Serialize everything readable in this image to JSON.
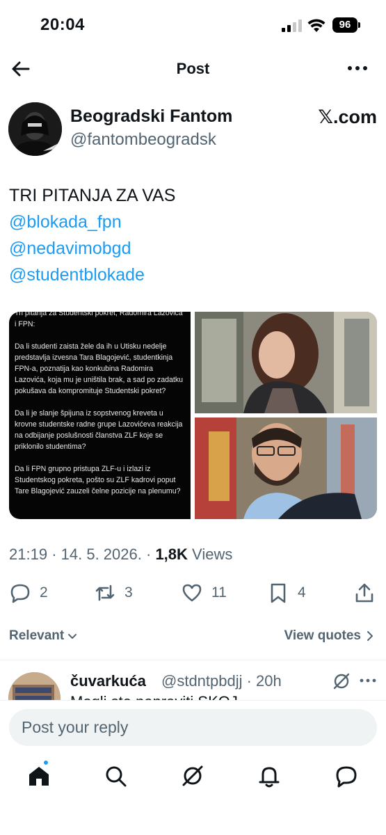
{
  "status_bar": {
    "time": "20:04",
    "battery": "96"
  },
  "nav": {
    "title": "Post"
  },
  "author": {
    "name": "Beogradski Fantom",
    "handle": "@fantombeogradsk",
    "source": "𝕏.com"
  },
  "post": {
    "text_lines": [
      "TRI PITANJA ZA VAS"
    ],
    "mentions": [
      "@blokada_fpn",
      "@nedavimobgd",
      "@studentblokade"
    ],
    "media_text": [
      "Tri pitanja za Studentski pokret, Radomira Lazovića i FPN:",
      "Da li studenti zaista žele da ih u Utisku nedelje predstavlja izvesna Tara Blagojević, studentkinja FPN-a, poznatija kao konkubina Radomira Lazovića, koja mu je uništila brak, a sad po zadatku pokušava da kompromituje Studentski pokret?",
      "Da li je slanje špijuna iz sopstvenog kreveta u krovne studentske radne grupe Lazovićeva reakcija na odbijanje poslušnosti članstva ZLF koje se priklonilo studentima?",
      "Da li FPN grupno pristupa ZLF-u i izlazi iz Studentskog pokreta, pošto su ZLF kadrovi poput Tare Blagojević zauzeli čelne pozicije na plenumu?"
    ]
  },
  "meta": {
    "time": "21:19",
    "date": "14. 5. 2026.",
    "views_count": "1,8K",
    "views_label": "Views"
  },
  "actions": {
    "replies": "2",
    "reposts": "3",
    "likes": "11",
    "bookmarks": "4"
  },
  "filters": {
    "sort_label": "Relevant",
    "quotes_label": "View quotes"
  },
  "reply": {
    "name": "čuvarkuća",
    "handle": "@stdntpbdjj · 20h",
    "text": "Mogli ste napraviti SKOJ..."
  },
  "compose": {
    "placeholder": "Post your reply"
  },
  "colors": {
    "accent": "#1d9bf0",
    "secondary_text": "#536471",
    "primary_text": "#0f1419"
  }
}
